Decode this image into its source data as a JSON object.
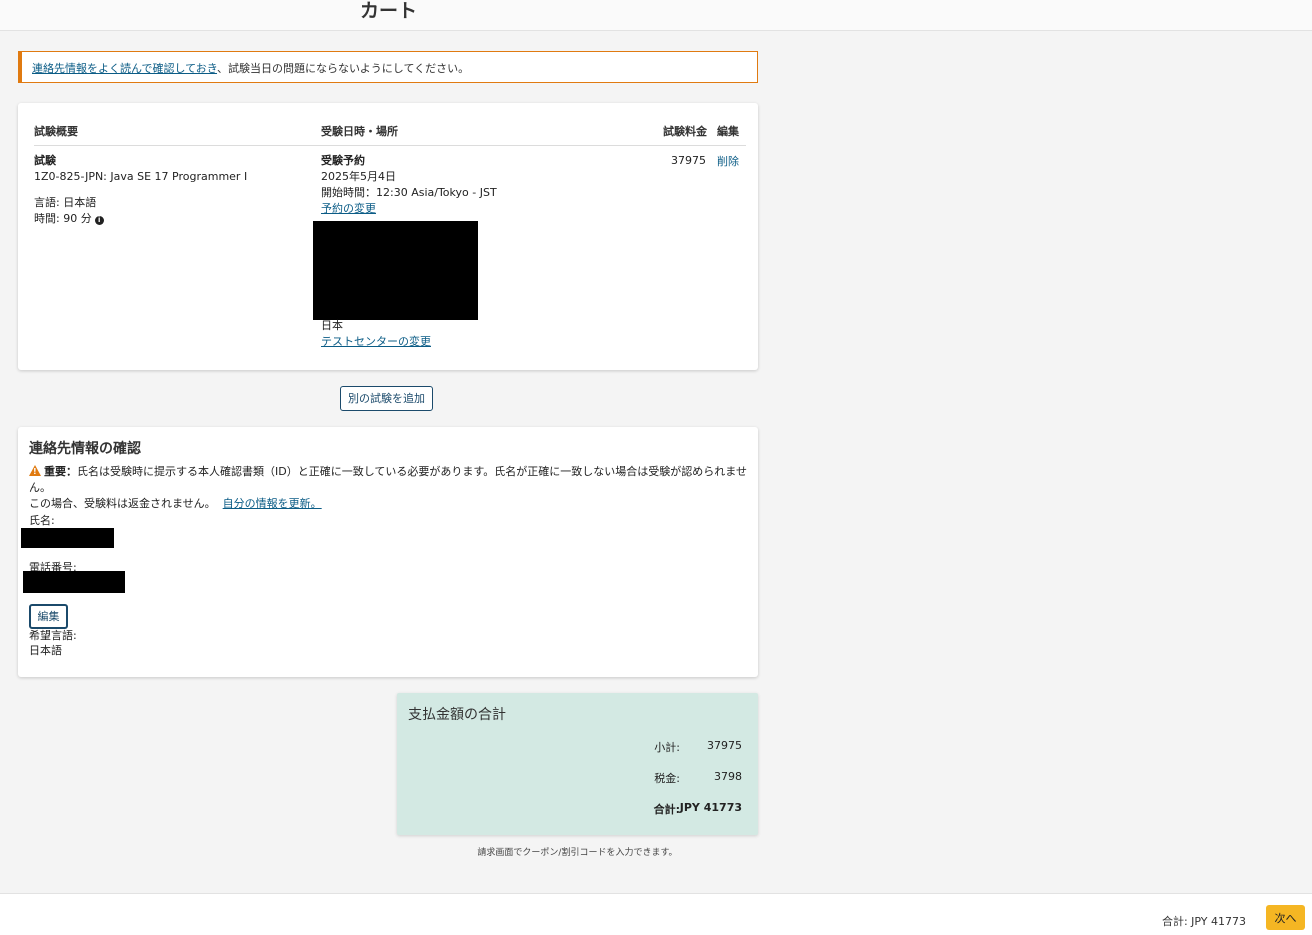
{
  "header": {
    "title": "カート"
  },
  "alert": {
    "link_text": "連絡先情報をよく読んで確認しておき",
    "rest_text": "、試験当日の問題にならないようにしてください。"
  },
  "exam_table": {
    "headers": {
      "summary": "試験概要",
      "datetime_location": "受験日時・場所",
      "fee": "試験料金",
      "edit": "編集"
    },
    "exam": {
      "label": "試験",
      "name": "1Z0-825-JPN: Java SE 17 Programmer I",
      "language": "言語: 日本語",
      "duration": "時間: 90 分"
    },
    "reservation": {
      "label": "受験予約",
      "date": "2025年5月4日",
      "start_time": "開始時間：12:30 Asia/Tokyo - JST",
      "change_link": "予約の変更",
      "country": "日本",
      "change_center_link": "テストセンターの変更"
    },
    "fee": "37975",
    "delete_link": "削除"
  },
  "add_exam_button": "別の試験を追加",
  "contact": {
    "title": "連絡先情報の確認",
    "warning_bold": "重要：",
    "warning_text": "氏名は受験時に提示する本人確認書類（ID）と正確に一致している必要があります。氏名が正確に一致しない場合は受験が認められません。",
    "warning_text2": "この場合、受験料は返金されません。",
    "update_link": "自分の情報を更新。",
    "name_label": "氏名:",
    "phone_label": "電話番号:",
    "edit_button": "編集",
    "language_label": "希望言語:",
    "language_value": "日本語"
  },
  "summary": {
    "title": "支払金額の合計",
    "subtotal_label": "小計:",
    "subtotal_value": "37975",
    "tax_label": "税金:",
    "tax_value": "3798",
    "total_label": "合計:",
    "total_value": "JPY 41773"
  },
  "coupon_note": "請求画面でクーポン/割引コードを入力できます。",
  "footer": {
    "total": "合計: JPY 41773",
    "next_button": "次へ"
  },
  "colors": {
    "accent_orange": "#e07a10",
    "link_blue": "#0b5c86",
    "summary_bg": "#d3e9e3",
    "next_button": "#f5b623"
  }
}
